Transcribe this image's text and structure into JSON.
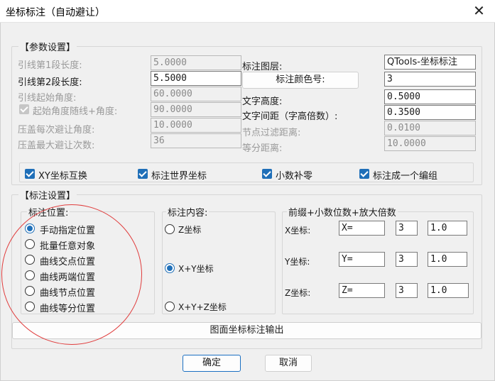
{
  "window": {
    "title": "坐标标注（自动避让）",
    "close_glyph": "✕"
  },
  "params": {
    "title": "【参数设置】",
    "left_fields": [
      {
        "label": "引线第1段长度:",
        "value": "5.0000"
      },
      {
        "label": "引线第2段长度:",
        "value": "5.5000"
      },
      {
        "label": "引线起始角度:",
        "value": "60.0000"
      },
      {
        "label": "起始角度随线+角度:",
        "value": "90.0000"
      },
      {
        "label": "压盖每次避让角度:",
        "value": "10.0000"
      },
      {
        "label": "压盖最大避让次数:",
        "value": "36"
      }
    ],
    "layer_label": "标注图层:",
    "layer_value": "QTools-坐标标注",
    "color_button": "标注颜色号:",
    "color_value": "3",
    "right_fields": [
      {
        "label": "文字高度:",
        "value": "0.5000"
      },
      {
        "label": "文字间距（字高倍数）:",
        "value": "0.3500"
      },
      {
        "label": "节点过滤距离:",
        "value": "0.0100"
      },
      {
        "label": "等分距离:",
        "value": "10.0000"
      }
    ],
    "checkboxes": [
      {
        "label": "XY坐标互换",
        "checked": true
      },
      {
        "label": "标注世界坐标",
        "checked": true
      },
      {
        "label": "小数补零",
        "checked": true
      },
      {
        "label": "标注成一个编组",
        "checked": true
      }
    ]
  },
  "annot": {
    "title": "【标注设置】",
    "position": {
      "title": "标注位置:",
      "options": [
        "手动指定位置",
        "批量任意对象",
        "曲线交点位置",
        "曲线两端位置",
        "曲线节点位置",
        "曲线等分位置"
      ],
      "selected": "手动指定位置"
    },
    "content": {
      "title": "标注内容:",
      "options": [
        "Z坐标",
        "X+Y坐标",
        "X+Y+Z坐标"
      ],
      "selected": "X+Y坐标"
    },
    "prefix": {
      "title": "前缀+小数位数+放大倍数",
      "rows": [
        {
          "label": "X坐标:",
          "prefix": "X=",
          "decimals": "3",
          "scale": "1.0"
        },
        {
          "label": "Y坐标:",
          "prefix": "Y=",
          "decimals": "3",
          "scale": "1.0"
        },
        {
          "label": "Z坐标:",
          "prefix": "Z=",
          "decimals": "3",
          "scale": "1.0"
        }
      ]
    },
    "export_button": "图面坐标标注输出"
  },
  "footer": {
    "ok": "确定",
    "cancel": "取消"
  },
  "colors": {
    "accent": "#1f6fb8",
    "annotation_circle": "#e03c3c"
  }
}
